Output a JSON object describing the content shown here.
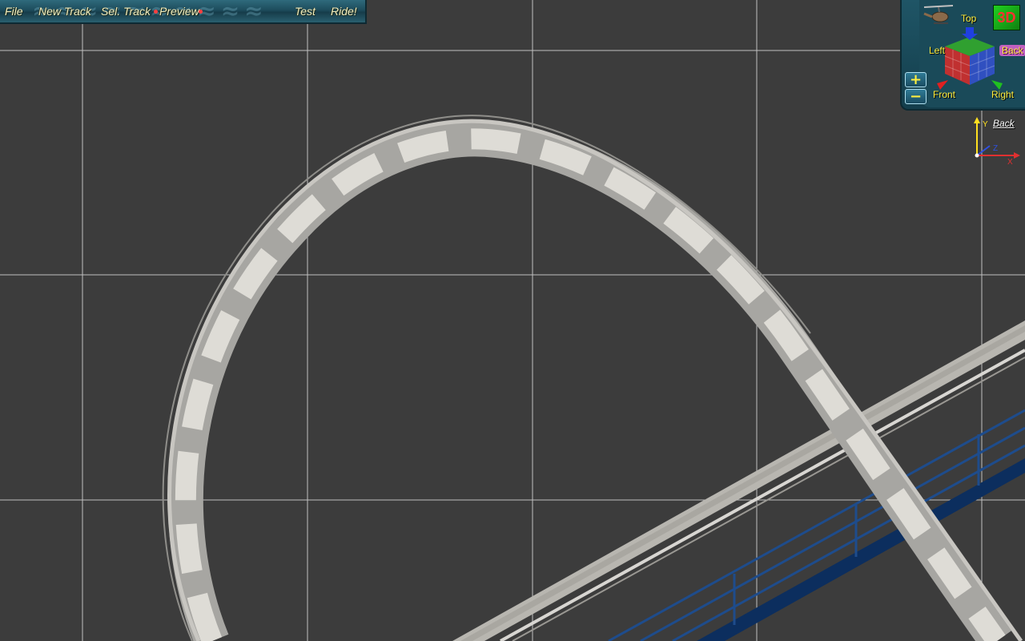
{
  "menu": {
    "file": "File",
    "new_track": "New Track",
    "sel_track": "Sel. Track",
    "preview": "Preview",
    "test": "Test",
    "ride": "Ride!"
  },
  "view_panel": {
    "top": "Top",
    "left": "Left",
    "back": "Back",
    "front": "Front",
    "right": "Right",
    "mode": "3D",
    "zoom_in": "+",
    "zoom_out": "−"
  },
  "axis_indicator": {
    "view_name": "Back",
    "y": "Y",
    "z": "Z",
    "x": "X"
  },
  "icons": {
    "helicopter": "helicopter-icon",
    "view_cube": "view-cube-icon",
    "axis_gizmo": "axis-gizmo-icon"
  },
  "colors": {
    "background": "#3c3c3c",
    "grid": "#d8d8d8",
    "track": "#c8c5bf",
    "support_rail": "#1e4c8c",
    "label_yellow": "#ffef40"
  }
}
